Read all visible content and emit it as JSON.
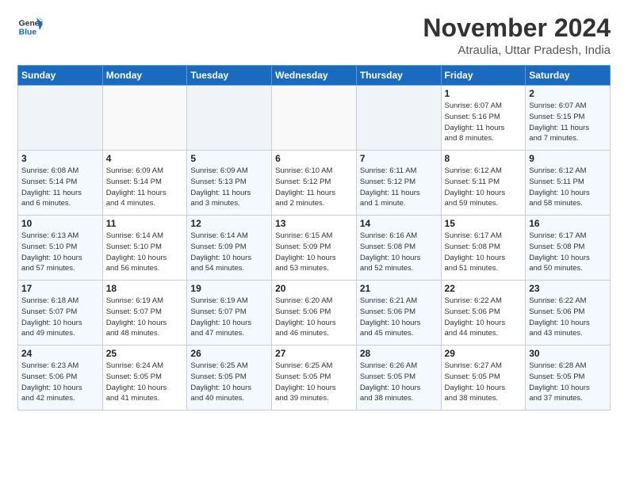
{
  "logo": {
    "line1": "General",
    "line2": "Blue"
  },
  "title": "November 2024",
  "location": "Atraulia, Uttar Pradesh, India",
  "headers": [
    "Sunday",
    "Monday",
    "Tuesday",
    "Wednesday",
    "Thursday",
    "Friday",
    "Saturday"
  ],
  "weeks": [
    [
      {
        "day": "",
        "info": ""
      },
      {
        "day": "",
        "info": ""
      },
      {
        "day": "",
        "info": ""
      },
      {
        "day": "",
        "info": ""
      },
      {
        "day": "",
        "info": ""
      },
      {
        "day": "1",
        "info": "Sunrise: 6:07 AM\nSunset: 5:16 PM\nDaylight: 11 hours\nand 8 minutes."
      },
      {
        "day": "2",
        "info": "Sunrise: 6:07 AM\nSunset: 5:15 PM\nDaylight: 11 hours\nand 7 minutes."
      }
    ],
    [
      {
        "day": "3",
        "info": "Sunrise: 6:08 AM\nSunset: 5:14 PM\nDaylight: 11 hours\nand 6 minutes."
      },
      {
        "day": "4",
        "info": "Sunrise: 6:09 AM\nSunset: 5:14 PM\nDaylight: 11 hours\nand 4 minutes."
      },
      {
        "day": "5",
        "info": "Sunrise: 6:09 AM\nSunset: 5:13 PM\nDaylight: 11 hours\nand 3 minutes."
      },
      {
        "day": "6",
        "info": "Sunrise: 6:10 AM\nSunset: 5:12 PM\nDaylight: 11 hours\nand 2 minutes."
      },
      {
        "day": "7",
        "info": "Sunrise: 6:11 AM\nSunset: 5:12 PM\nDaylight: 11 hours\nand 1 minute."
      },
      {
        "day": "8",
        "info": "Sunrise: 6:12 AM\nSunset: 5:11 PM\nDaylight: 10 hours\nand 59 minutes."
      },
      {
        "day": "9",
        "info": "Sunrise: 6:12 AM\nSunset: 5:11 PM\nDaylight: 10 hours\nand 58 minutes."
      }
    ],
    [
      {
        "day": "10",
        "info": "Sunrise: 6:13 AM\nSunset: 5:10 PM\nDaylight: 10 hours\nand 57 minutes."
      },
      {
        "day": "11",
        "info": "Sunrise: 6:14 AM\nSunset: 5:10 PM\nDaylight: 10 hours\nand 56 minutes."
      },
      {
        "day": "12",
        "info": "Sunrise: 6:14 AM\nSunset: 5:09 PM\nDaylight: 10 hours\nand 54 minutes."
      },
      {
        "day": "13",
        "info": "Sunrise: 6:15 AM\nSunset: 5:09 PM\nDaylight: 10 hours\nand 53 minutes."
      },
      {
        "day": "14",
        "info": "Sunrise: 6:16 AM\nSunset: 5:08 PM\nDaylight: 10 hours\nand 52 minutes."
      },
      {
        "day": "15",
        "info": "Sunrise: 6:17 AM\nSunset: 5:08 PM\nDaylight: 10 hours\nand 51 minutes."
      },
      {
        "day": "16",
        "info": "Sunrise: 6:17 AM\nSunset: 5:08 PM\nDaylight: 10 hours\nand 50 minutes."
      }
    ],
    [
      {
        "day": "17",
        "info": "Sunrise: 6:18 AM\nSunset: 5:07 PM\nDaylight: 10 hours\nand 49 minutes."
      },
      {
        "day": "18",
        "info": "Sunrise: 6:19 AM\nSunset: 5:07 PM\nDaylight: 10 hours\nand 48 minutes."
      },
      {
        "day": "19",
        "info": "Sunrise: 6:19 AM\nSunset: 5:07 PM\nDaylight: 10 hours\nand 47 minutes."
      },
      {
        "day": "20",
        "info": "Sunrise: 6:20 AM\nSunset: 5:06 PM\nDaylight: 10 hours\nand 46 minutes."
      },
      {
        "day": "21",
        "info": "Sunrise: 6:21 AM\nSunset: 5:06 PM\nDaylight: 10 hours\nand 45 minutes."
      },
      {
        "day": "22",
        "info": "Sunrise: 6:22 AM\nSunset: 5:06 PM\nDaylight: 10 hours\nand 44 minutes."
      },
      {
        "day": "23",
        "info": "Sunrise: 6:22 AM\nSunset: 5:06 PM\nDaylight: 10 hours\nand 43 minutes."
      }
    ],
    [
      {
        "day": "24",
        "info": "Sunrise: 6:23 AM\nSunset: 5:06 PM\nDaylight: 10 hours\nand 42 minutes."
      },
      {
        "day": "25",
        "info": "Sunrise: 6:24 AM\nSunset: 5:05 PM\nDaylight: 10 hours\nand 41 minutes."
      },
      {
        "day": "26",
        "info": "Sunrise: 6:25 AM\nSunset: 5:05 PM\nDaylight: 10 hours\nand 40 minutes."
      },
      {
        "day": "27",
        "info": "Sunrise: 6:25 AM\nSunset: 5:05 PM\nDaylight: 10 hours\nand 39 minutes."
      },
      {
        "day": "28",
        "info": "Sunrise: 6:26 AM\nSunset: 5:05 PM\nDaylight: 10 hours\nand 38 minutes."
      },
      {
        "day": "29",
        "info": "Sunrise: 6:27 AM\nSunset: 5:05 PM\nDaylight: 10 hours\nand 38 minutes."
      },
      {
        "day": "30",
        "info": "Sunrise: 6:28 AM\nSunset: 5:05 PM\nDaylight: 10 hours\nand 37 minutes."
      }
    ]
  ]
}
